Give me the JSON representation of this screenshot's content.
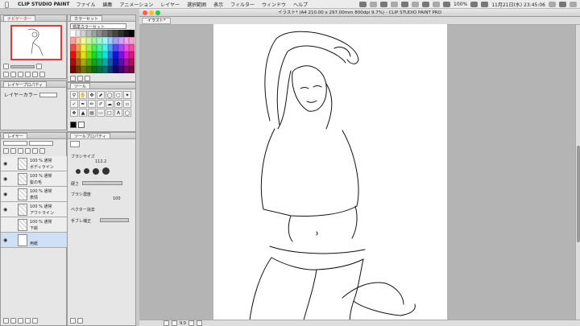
{
  "menubar": {
    "app_name": "CLIP STUDIO PAINT",
    "items": [
      "ファイル",
      "編集",
      "アニメーション",
      "レイヤー",
      "選択範囲",
      "表示",
      "フィルター",
      "ウィンドウ",
      "ヘルプ"
    ],
    "battery": "100%",
    "clock": "11月21日(水) 23:45:06"
  },
  "navigator": {
    "tab": "ナビゲーター",
    "zoom": "9.7"
  },
  "colorset": {
    "tab": "カラーセット",
    "set_name": "標準カラーセット"
  },
  "layerprop": {
    "tab": "レイヤープロパティ",
    "layer_color_label": "レイヤーカラー"
  },
  "tool": {
    "tab": "ツール"
  },
  "layers": {
    "tab": "レイヤー",
    "list": [
      {
        "pct": "100 % 通常",
        "name": "ボディライン"
      },
      {
        "pct": "100 % 通常",
        "name": "髪の毛"
      },
      {
        "pct": "100 % 通常",
        "name": "表情"
      },
      {
        "pct": "100 % 通常",
        "name": "アウトライン"
      },
      {
        "pct": "100 % 通常",
        "name": "下絵"
      },
      {
        "pct": "",
        "name": "用紙"
      }
    ]
  },
  "subtool": {
    "tab": "ツールプロパティ",
    "brush_size_label": "ブラシサイズ",
    "brush_size": "112.2",
    "hardness_label": "硬さ",
    "density_label": "ブラシ濃度",
    "density": "100",
    "vector_label": "ベクター消去",
    "stabilizer_label": "手ブレ補正"
  },
  "canvas": {
    "window_title": "イラスト* (A4 210.00 x 297.00mm 800dpi 9.7%) - CLIP STUDIO PAINT PRO",
    "tab_label": "イラスト*",
    "zoom_value": "9.0"
  },
  "colors": {
    "red": "#ff5f57",
    "yellow": "#febc2e",
    "green": "#28c840",
    "nav_frame": "#e03a3a"
  }
}
